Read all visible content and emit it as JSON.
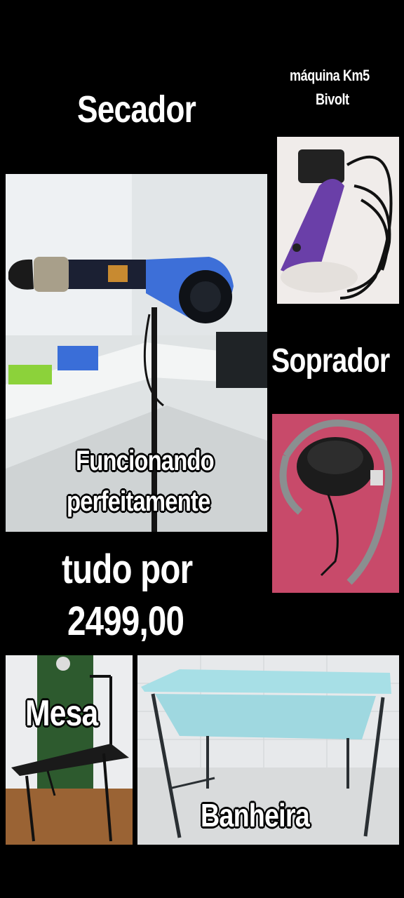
{
  "labels": {
    "secador": "Secador",
    "maquina_line1": "máquina Km5",
    "maquina_line2": "Bivolt",
    "soprador": "Soprador",
    "funcionando_line1": "Funcionando",
    "funcionando_line2": "perfeitamente",
    "tudo_line1": "tudo por",
    "tudo_line2": "2499,00",
    "mesa": "Mesa",
    "banheira": "Banheira"
  },
  "colors": {
    "background": "#000000",
    "dryer_blue": "#3d6fd8",
    "clipper_purple": "#6a3fa8",
    "blower_bg": "#c84a6a",
    "tub_blue": "#9fd8e0",
    "text": "#ffffff"
  }
}
